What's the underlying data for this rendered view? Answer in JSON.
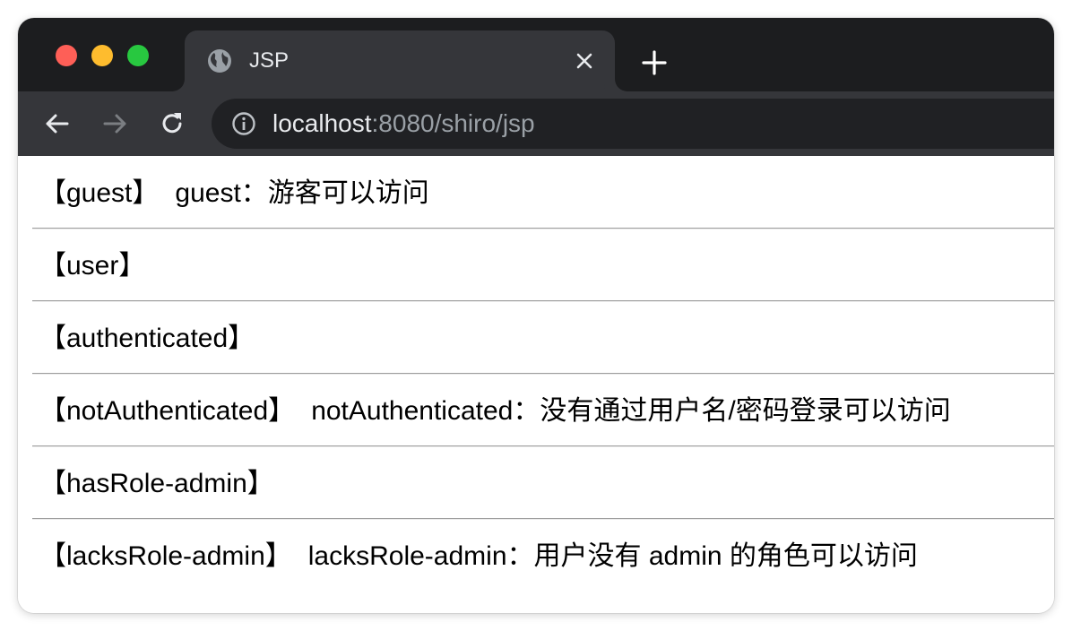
{
  "colors": {
    "titlebar": "#1c1d1f",
    "tab_active": "#35363a",
    "omnibox": "#202124",
    "close": "#fe5f57",
    "minimize": "#febc2e",
    "maximize": "#28c840"
  },
  "browser": {
    "tab": {
      "title": "JSP",
      "favicon": "globe-icon",
      "close_icon": "close-icon"
    },
    "new_tab_icon": "plus-icon",
    "nav": {
      "back_icon": "arrow-left-icon",
      "forward_icon": "arrow-right-icon",
      "reload_icon": "reload-icon"
    },
    "address": {
      "info_icon": "info-icon",
      "host": "localhost",
      "rest": ":8080/shiro/jsp"
    }
  },
  "page": {
    "items": [
      {
        "label": "【guest】",
        "text": "guest：游客可以访问"
      },
      {
        "label": "【user】",
        "text": ""
      },
      {
        "label": "【authenticated】",
        "text": ""
      },
      {
        "label": "【notAuthenticated】",
        "text": "notAuthenticated：没有通过用户名/密码登录可以访问"
      },
      {
        "label": "【hasRole-admin】",
        "text": ""
      },
      {
        "label": "【lacksRole-admin】",
        "text": "lacksRole-admin：用户没有 admin 的角色可以访问"
      }
    ]
  }
}
